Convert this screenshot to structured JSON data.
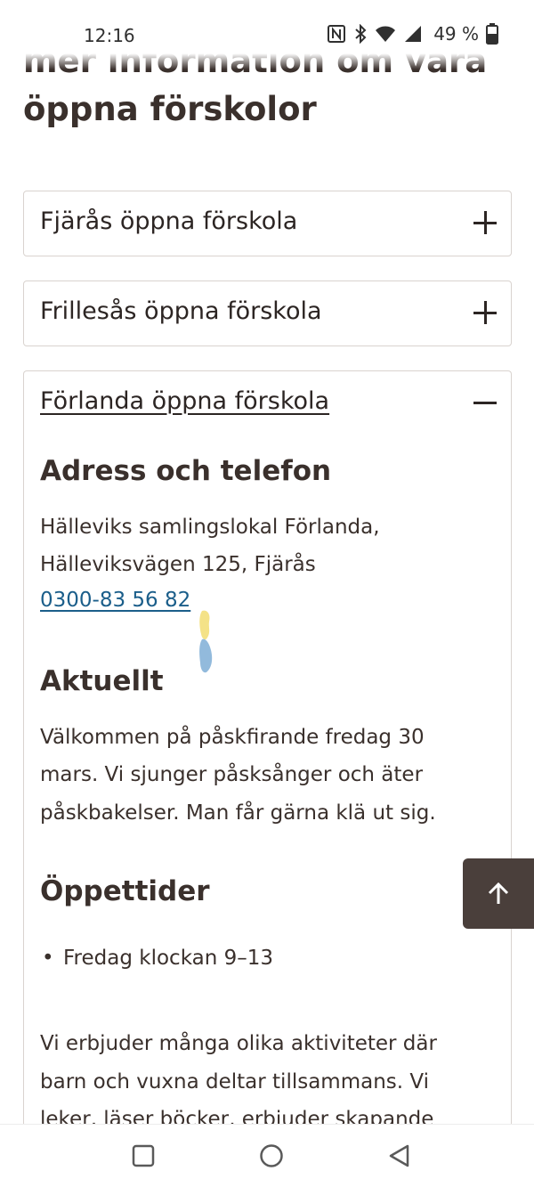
{
  "status_bar": {
    "time": "12:16",
    "battery": "49 %",
    "icons": [
      "nfc-icon",
      "bluetooth-icon",
      "wifi-icon",
      "signal-icon",
      "battery-icon"
    ]
  },
  "page": {
    "heading_line1": "mer information om våra",
    "heading_line2": "öppna förskolor"
  },
  "accordion": [
    {
      "title": "Fjärås öppna förskola",
      "state": "collapsed",
      "toggle_icon": "plus-icon"
    },
    {
      "title": "Frillesås öppna förskola",
      "state": "collapsed",
      "toggle_icon": "plus-icon"
    },
    {
      "title": "Förlanda öppna förskola",
      "state": "expanded",
      "toggle_icon": "minus-icon",
      "address_heading": "Adress och telefon",
      "address_line1": "Hälleviks samlingslokal Förlanda,",
      "address_line2": "Hälleviksvägen 125, Fjärås",
      "phone": "0300-83 56 82",
      "news_heading": "Aktuellt",
      "news_line1": "Välkommen på påskfirande fredag 30",
      "news_line2": "mars. Vi sjunger påsksånger och äter",
      "news_line3": "påskbakelser. Man får gärna klä ut sig.",
      "hours_heading": "Öppettider",
      "hours_item": "Fredag klockan 9–13",
      "activities_line1": "Vi erbjuder många olika aktiviteter där",
      "activities_line2": "barn och vuxna deltar tillsammans. Vi",
      "activities_line3": "leker, läser böcker, erbjuder skapande"
    }
  ],
  "colors": {
    "text": "#3a302c",
    "link": "#1b5e8a",
    "border": "#d9d3cf",
    "back_to_top_bg": "#4a3f3b"
  },
  "nav_bar": {
    "buttons": [
      "recents-button",
      "home-button",
      "back-button"
    ]
  }
}
